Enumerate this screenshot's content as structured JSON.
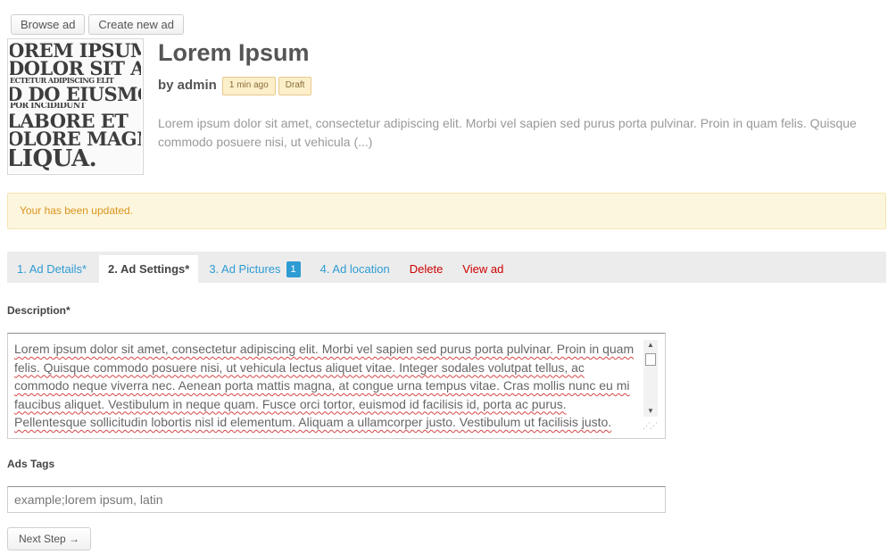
{
  "toolbar": {
    "browse_label": "Browse ad",
    "create_label": "Create new ad"
  },
  "thumbnail": {
    "lines": [
      "OREM IPSUM",
      "DOLOR SIT AMET",
      "ECTETUR ADIPISCING ELIT",
      "D DO EIUSMOD",
      "POR INCIDIDUNT",
      "LABORE ET",
      "OLORE MAGNA",
      "LIQUA."
    ]
  },
  "ad": {
    "title": "Lorem Ipsum",
    "author": "by admin",
    "time_badge": "1 min ago",
    "status_badge": "Draft",
    "excerpt": "Lorem ipsum dolor sit amet, consectetur adipiscing elit. Morbi vel sapien sed purus porta pulvinar. Proin in quam felis. Quisque commodo posuere nisi, ut vehicula (...)"
  },
  "alert": {
    "message": "Your has been updated."
  },
  "tabs": [
    {
      "label": "1. Ad Details*"
    },
    {
      "label": "2. Ad Settings*"
    },
    {
      "label": "3. Ad Pictures",
      "count": "1"
    },
    {
      "label": "4. Ad location"
    },
    {
      "label": "Delete"
    },
    {
      "label": "View ad"
    }
  ],
  "form": {
    "description_label": "Description*",
    "description_value": "Lorem ipsum dolor sit amet, consectetur adipiscing elit. Morbi vel sapien sed purus porta pulvinar. Proin in quam felis. Quisque commodo posuere nisi, ut vehicula lectus aliquet vitae. Integer sodales volutpat tellus, ac commodo neque viverra nec. Aenean porta mattis magna, at congue urna tempus vitae. Cras mollis nunc eu mi faucibus aliquet. Vestibulum in neque quam. Fusce orci tortor, euismod id facilisis id, porta ac purus. Pellentesque sollicitudin lobortis nisl id elementum. Aliquam a ullamcorper justo. Vestibulum ut facilisis justo.",
    "tags_label": "Ads Tags",
    "tags_value": "example;lorem ipsum, latin",
    "next_label": "Next Step →"
  },
  "colors": {
    "link": "#2e9cd3",
    "danger": "#cc0000",
    "alert_text": "#d9941e",
    "alert_bg": "#fdf6de",
    "badge_bg": "#fcefc9"
  }
}
